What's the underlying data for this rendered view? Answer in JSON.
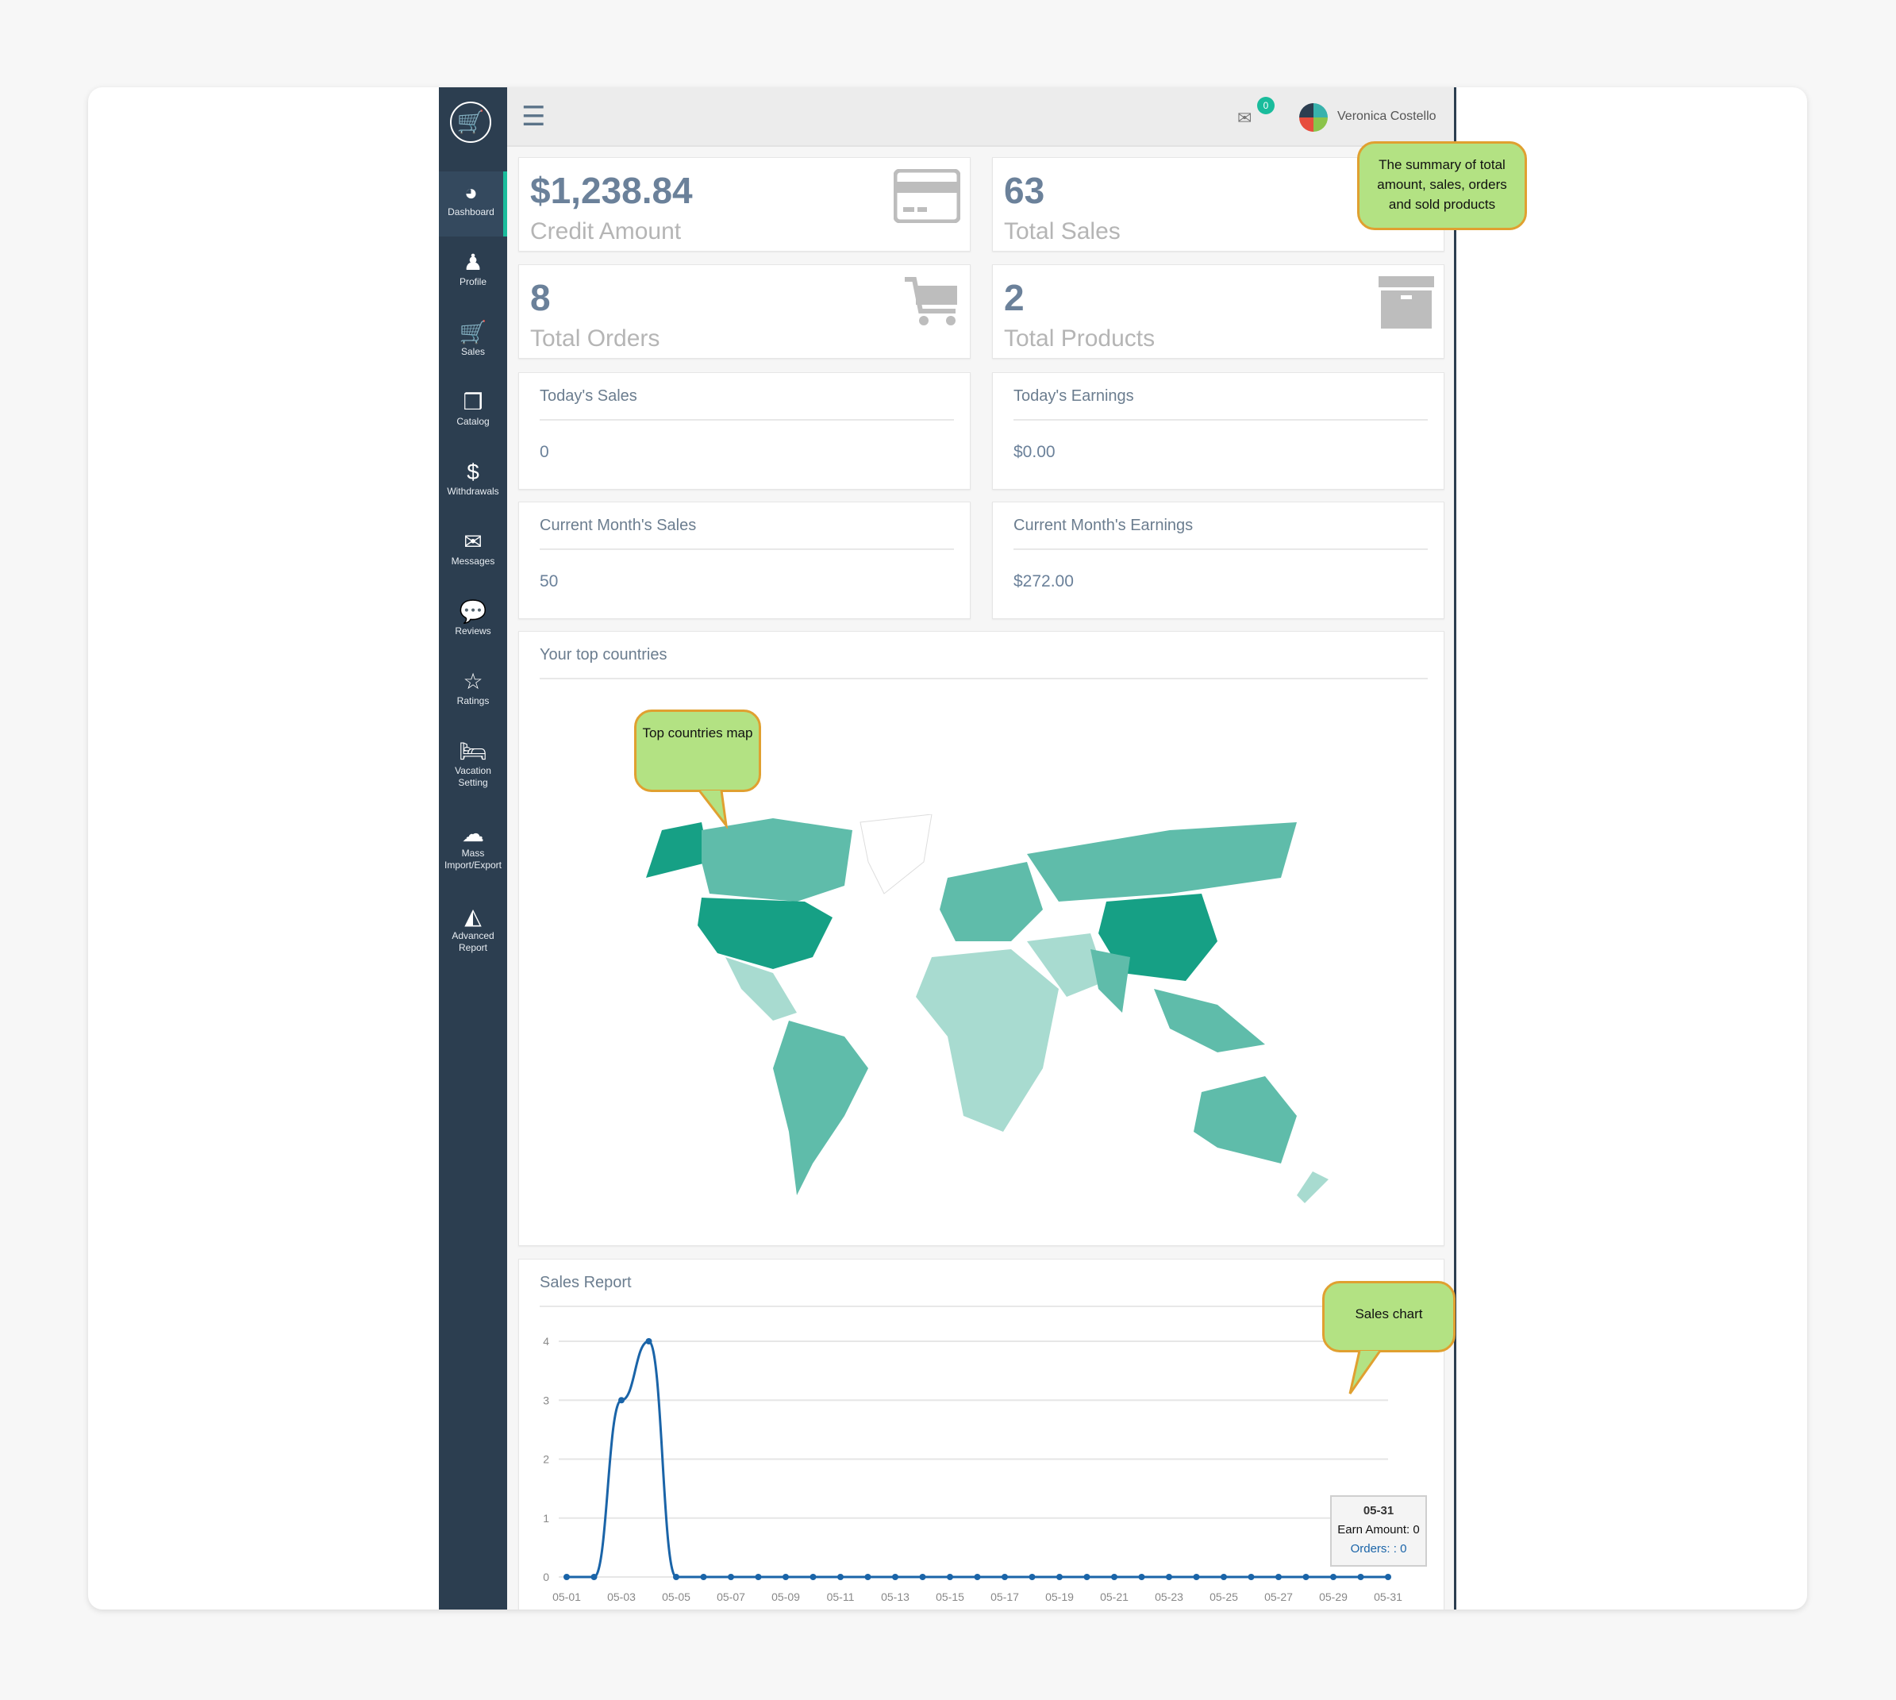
{
  "sidebar": {
    "items": [
      {
        "label": "Dashboard",
        "icon": "dashboard-icon",
        "glyph": "◕"
      },
      {
        "label": "Profile",
        "icon": "user-icon",
        "glyph": "♟"
      },
      {
        "label": "Sales",
        "icon": "cart-plus-icon",
        "glyph": "🛒"
      },
      {
        "label": "Catalog",
        "icon": "cubes-icon",
        "glyph": "❒"
      },
      {
        "label": "Withdrawals",
        "icon": "dollar-icon",
        "glyph": "$"
      },
      {
        "label": "Messages",
        "icon": "envelope-icon",
        "glyph": "✉"
      },
      {
        "label": "Reviews",
        "icon": "comment-icon",
        "glyph": "💬"
      },
      {
        "label": "Ratings",
        "icon": "star-icon",
        "glyph": "☆"
      },
      {
        "label": "Vacation Setting",
        "icon": "bed-icon",
        "glyph": "🛏"
      },
      {
        "label": "Mass Import/Export",
        "icon": "cloud-upload-icon",
        "glyph": "☁"
      },
      {
        "label": "Advanced Report",
        "icon": "area-chart-icon",
        "glyph": "◭"
      }
    ]
  },
  "header": {
    "notifications": "0",
    "user_name": "Veronica Costello"
  },
  "stats": [
    {
      "value": "$1,238.84",
      "label": "Credit Amount",
      "icon": "credit-card-icon"
    },
    {
      "value": "63",
      "label": "Total Sales",
      "icon": "tag-icon"
    },
    {
      "value": "8",
      "label": "Total Orders",
      "icon": "cart-icon"
    },
    {
      "value": "2",
      "label": "Total Products",
      "icon": "archive-icon"
    }
  ],
  "info": [
    {
      "title": "Today's Sales",
      "value": "0"
    },
    {
      "title": "Today's Earnings",
      "value": "$0.00"
    },
    {
      "title": "Current Month's Sales",
      "value": "50"
    },
    {
      "title": "Current Month's Earnings",
      "value": "$272.00"
    }
  ],
  "map": {
    "title": "Your top countries",
    "colors": {
      "high": "#16a085",
      "mid": "#5fbcaa",
      "low": "#a8dbd0",
      "none": "#ffffff"
    }
  },
  "callouts": {
    "summary": "The summary of total amount, sales, orders and sold products",
    "map": "Top countries map",
    "chart": "Sales chart"
  },
  "chart_data": {
    "type": "line",
    "title": "Sales Report",
    "x": [
      "05-01",
      "05-02",
      "05-03",
      "05-04",
      "05-05",
      "05-06",
      "05-07",
      "05-08",
      "05-09",
      "05-10",
      "05-11",
      "05-12",
      "05-13",
      "05-14",
      "05-15",
      "05-16",
      "05-17",
      "05-18",
      "05-19",
      "05-20",
      "05-21",
      "05-22",
      "05-23",
      "05-24",
      "05-25",
      "05-26",
      "05-27",
      "05-28",
      "05-29",
      "05-30",
      "05-31"
    ],
    "values": [
      0,
      0,
      3,
      4,
      0,
      0,
      0,
      0,
      0,
      0,
      0,
      0,
      0,
      0,
      0,
      0,
      0,
      0,
      0,
      0,
      0,
      0,
      0,
      0,
      0,
      0,
      0,
      0,
      0,
      0,
      0
    ],
    "yticks": [
      "0",
      "1",
      "2",
      "3",
      "4"
    ],
    "ylim": [
      0,
      4
    ],
    "grid": true,
    "color": "#1a64a8",
    "tooltip": {
      "date": "05-31",
      "earn": "Earn Amount: 0",
      "orders": "Orders: : 0"
    }
  }
}
